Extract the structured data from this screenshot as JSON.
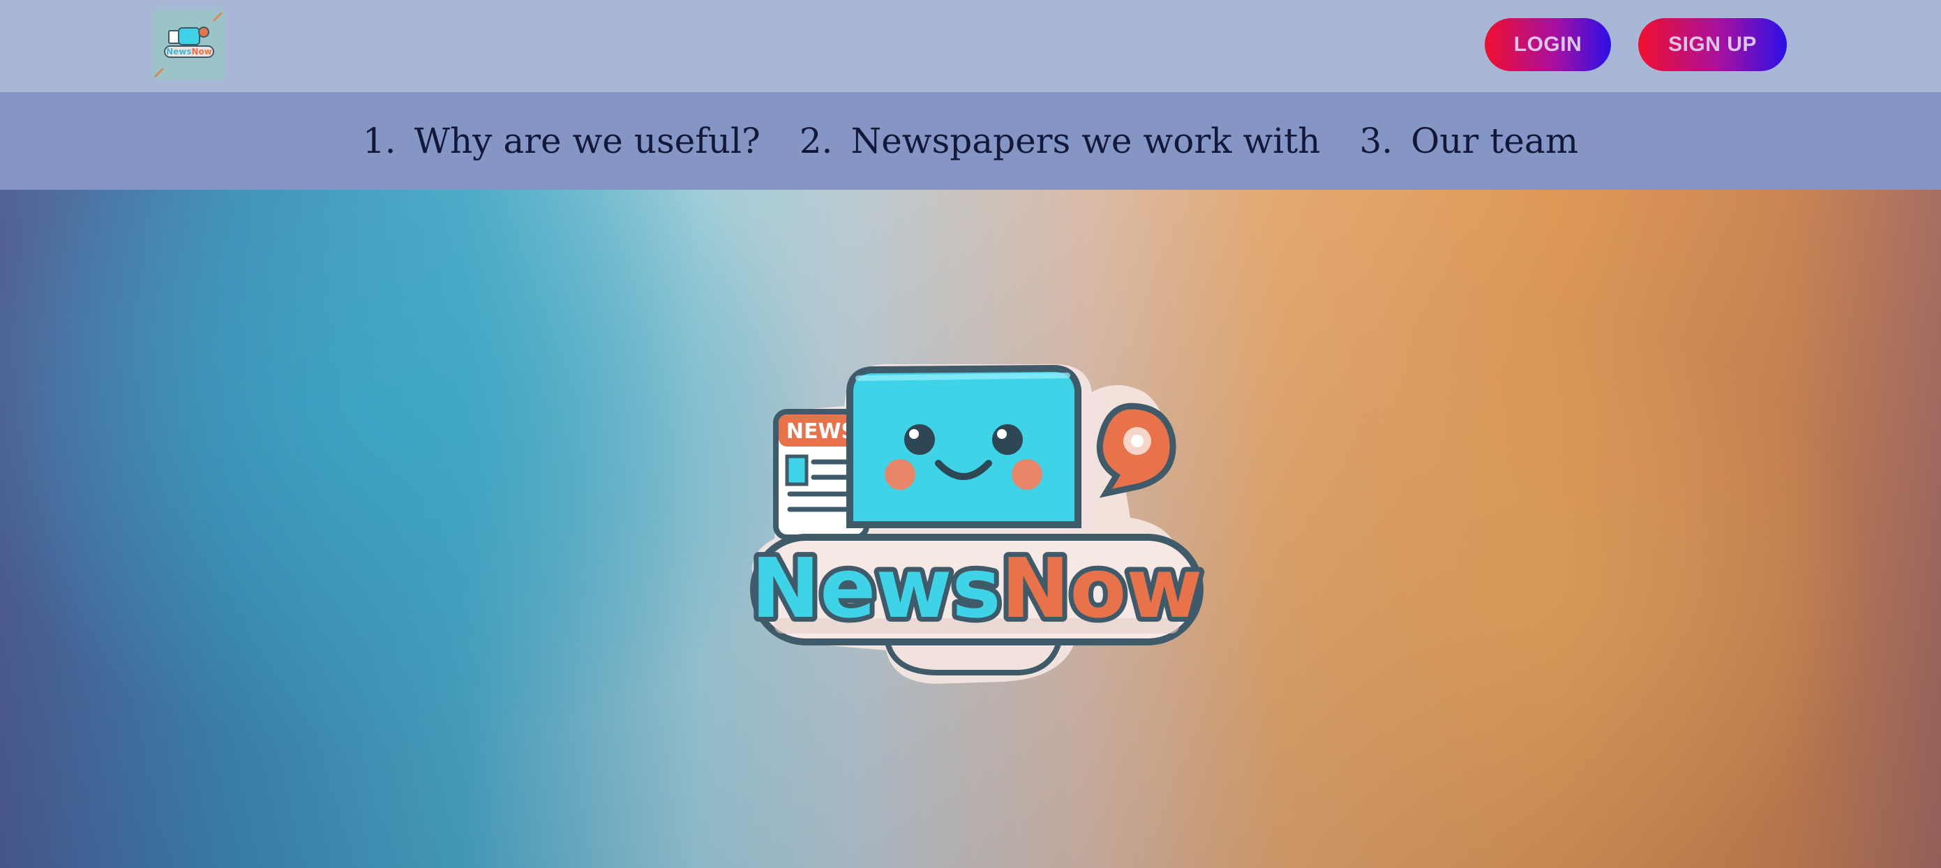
{
  "header": {
    "logo_text": "NewsNow",
    "login_label": "LOGIN",
    "signup_label": "SIGN UP"
  },
  "nav": {
    "items": [
      {
        "number": "1.",
        "label": "Why are we useful?"
      },
      {
        "number": "2.",
        "label": "Newspapers we work with"
      },
      {
        "number": "3.",
        "label": "Our team"
      }
    ]
  },
  "hero": {
    "logo_badge": "NEWS",
    "logo_word_1": "News",
    "logo_word_2": "Now"
  },
  "colors": {
    "topbar": "#a9b7d6",
    "navbar": "#8596c4",
    "button_gradient_start": "#f0102f",
    "button_gradient_end": "#2a10e8",
    "logo_cyan": "#3fd3e8",
    "logo_orange": "#e8734a"
  }
}
